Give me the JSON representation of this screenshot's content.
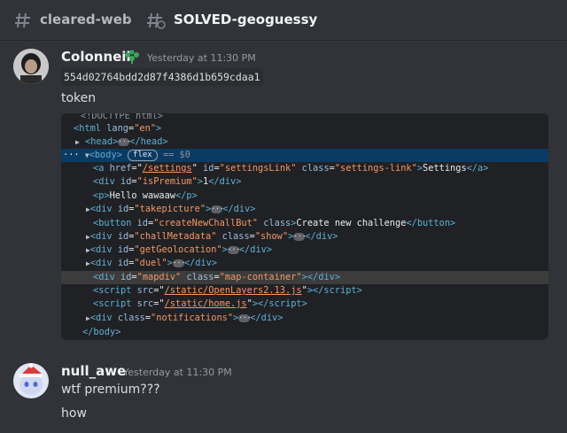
{
  "header": {
    "channel_parent": "cleared-web",
    "thread_name": "SOLVED-geoguessy",
    "thread_icon": "thread-hash-icon",
    "channel_icon": "hash-icon"
  },
  "messages": [
    {
      "author": "Colonneil",
      "timestamp": "Yesterday at 11:30 PM",
      "badge_icon": "sprout-icon",
      "code_text": "554d02764bdd2d87f4386d1b659cdaa1",
      "text": "token",
      "attachment": {
        "lines": [
          {
            "indent": 1,
            "kind": "cut",
            "text": "<!DOCTYPE html>"
          },
          {
            "indent": 0,
            "kind": "open",
            "open": "<html ",
            "attrs": [
              [
                "lang",
                "\"en\""
              ]
            ],
            "close": ">"
          },
          {
            "indent": 1,
            "kind": "collapsed",
            "tag": "head"
          },
          {
            "indent": 1,
            "kind": "body",
            "badge": "flex",
            "eq": "== $0"
          },
          {
            "indent": 2,
            "kind": "a",
            "href": "/settings",
            "id": "\"settingsLink\"",
            "class": "\"settings-link\"",
            "inner": "Settings"
          },
          {
            "indent": 2,
            "kind": "el",
            "tag": "div",
            "attrs": [
              [
                "id",
                "\"isPremium\""
              ]
            ],
            "inner": "1"
          },
          {
            "indent": 2,
            "kind": "el",
            "tag": "p",
            "attrs": [],
            "inner": "Hello wawaaw"
          },
          {
            "indent": 2,
            "kind": "collapsed-attr",
            "tag": "div",
            "attrs": [
              [
                "id",
                "\"takepicture\""
              ]
            ]
          },
          {
            "indent": 2,
            "kind": "el",
            "tag": "button",
            "attrs": [
              [
                "id",
                "\"createNewChallBut\""
              ],
              [
                "class",
                ""
              ]
            ],
            "inner": "Create new challenge"
          },
          {
            "indent": 2,
            "kind": "collapsed-attr",
            "tag": "div",
            "attrs": [
              [
                "id",
                "\"challMetadata\""
              ],
              [
                "class",
                "\"show\""
              ]
            ]
          },
          {
            "indent": 2,
            "kind": "collapsed-attr",
            "tag": "div",
            "attrs": [
              [
                "id",
                "\"getGeolocation\""
              ]
            ]
          },
          {
            "indent": 2,
            "kind": "collapsed-attr",
            "tag": "div",
            "attrs": [
              [
                "id",
                "\"duel\""
              ]
            ]
          },
          {
            "indent": 2,
            "kind": "el",
            "tag": "div",
            "attrs": [
              [
                "id",
                "\"mapdiv\""
              ],
              [
                "class",
                "\"map-container\""
              ]
            ],
            "inner": ""
          },
          {
            "indent": 2,
            "kind": "script",
            "src": "/static/OpenLayers2.13.js"
          },
          {
            "indent": 2,
            "kind": "script",
            "src": "/static/home.js"
          },
          {
            "indent": 2,
            "kind": "collapsed-attr",
            "tag": "div",
            "attrs": [
              [
                "class",
                "\"notifications\""
              ]
            ]
          },
          {
            "indent": 1,
            "kind": "close",
            "text": "</body>"
          }
        ]
      }
    },
    {
      "author": "null_awe",
      "timestamp": "Yesterday at 11:30 PM",
      "lines": [
        "wtf premium???",
        "how"
      ]
    }
  ],
  "colors": {
    "background": "#313338",
    "username": "#f2f3f5",
    "devtools_bg": "#202124",
    "selected_row": "#0a3b63",
    "tag": "#5db0d7",
    "attr": "#9bbbdc",
    "value": "#f29766"
  }
}
